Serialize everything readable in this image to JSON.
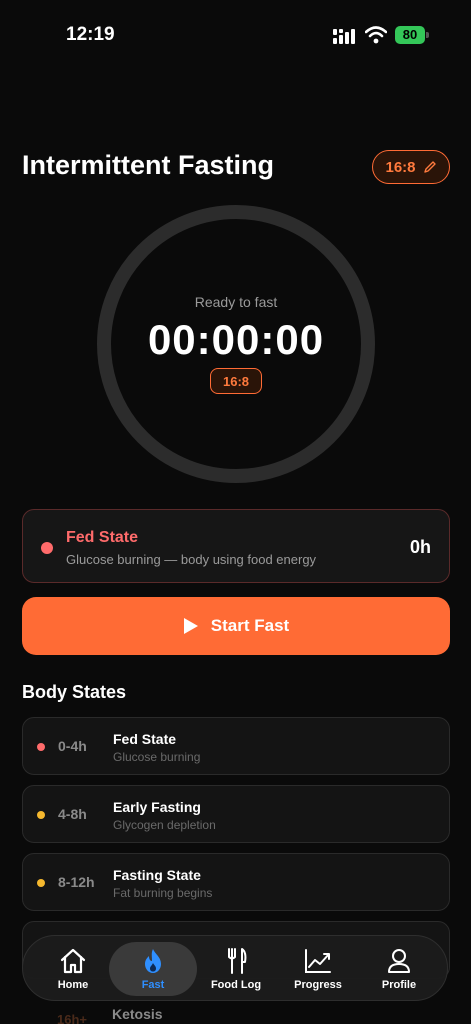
{
  "status_bar": {
    "time": "12:19",
    "battery": "80"
  },
  "header": {
    "title": "Intermittent Fasting",
    "plan": "16:8"
  },
  "timer": {
    "status": "Ready to fast",
    "value": "00:00:00",
    "plan": "16:8"
  },
  "current_state": {
    "title": "Fed State",
    "description": "Glucose burning — body using food energy",
    "hours": "0h"
  },
  "start_button": {
    "label": "Start Fast"
  },
  "body_states": {
    "title": "Body States",
    "items": [
      {
        "range": "0-4h",
        "name": "Fed State",
        "desc": "Glucose burning",
        "color": "#ff6b6b"
      },
      {
        "range": "4-8h",
        "name": "Early Fasting",
        "desc": "Glycogen depletion",
        "color": "#f5b82e"
      },
      {
        "range": "8-12h",
        "name": "Fasting State",
        "desc": "Fat burning begins",
        "color": "#f5b82e"
      },
      {
        "range": "16h+",
        "name": "Ketosis",
        "desc": "",
        "color": "#ff6b35"
      }
    ]
  },
  "tab_bar": {
    "active": "Fast",
    "accent": "#2f8fff",
    "tabs": [
      {
        "label": "Home",
        "icon": "home-icon"
      },
      {
        "label": "Fast",
        "icon": "flame-icon"
      },
      {
        "label": "Food Log",
        "icon": "fork-knife-icon"
      },
      {
        "label": "Progress",
        "icon": "chart-line-icon"
      },
      {
        "label": "Profile",
        "icon": "person-icon"
      }
    ]
  },
  "colors": {
    "accent": "#ff6b35",
    "fed": "#ff6b6b",
    "background": "#0a0a0a"
  }
}
